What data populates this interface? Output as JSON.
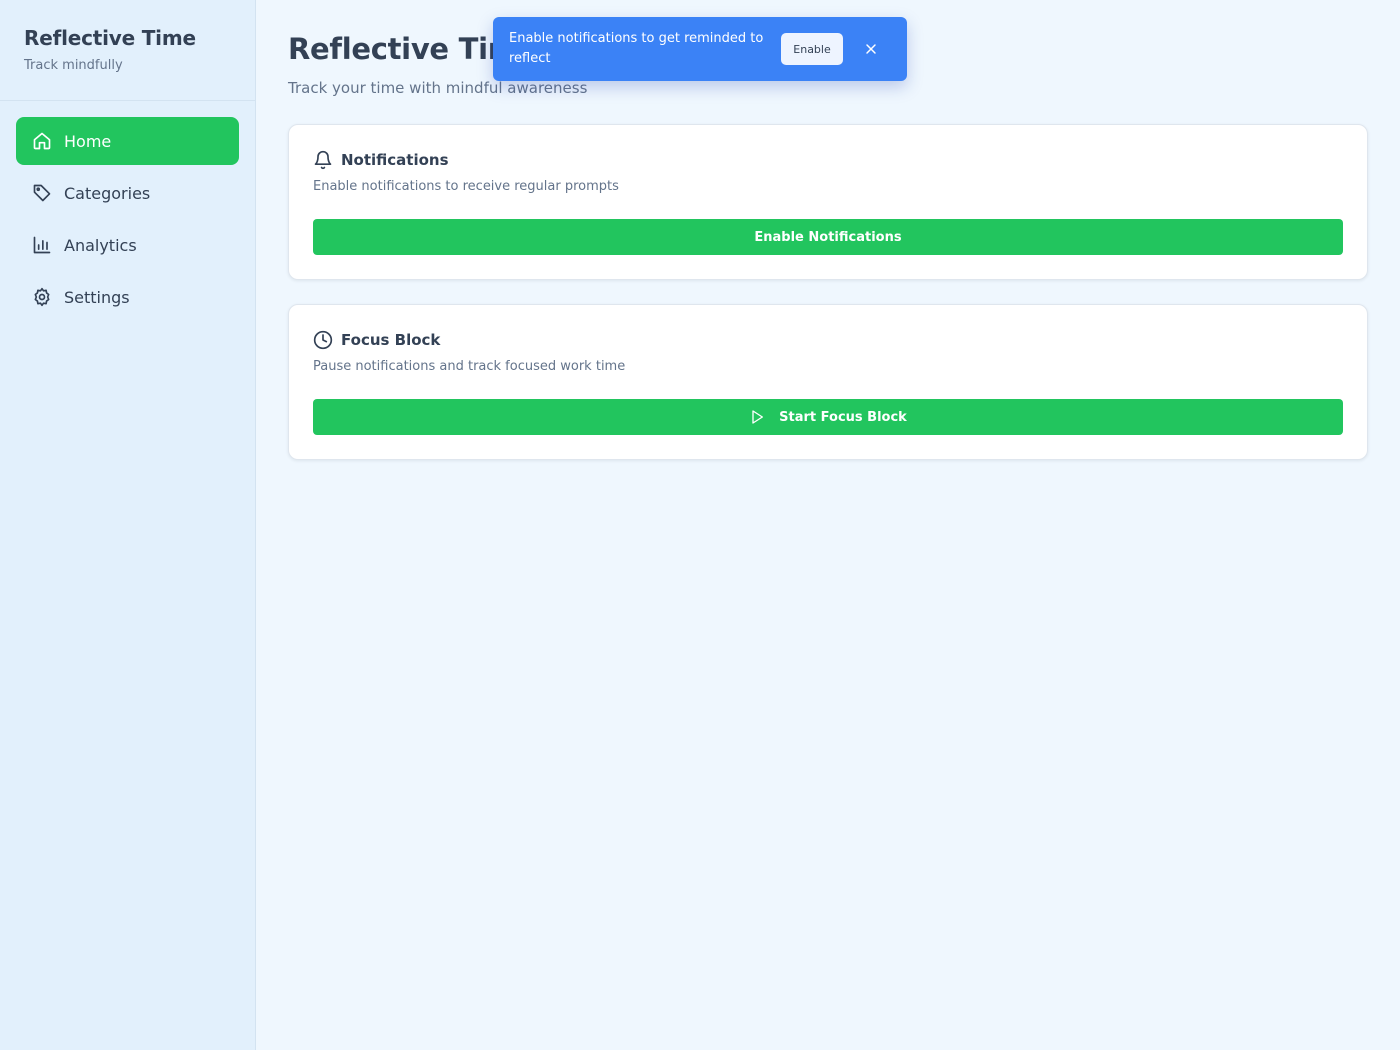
{
  "sidebar": {
    "title": "Reflective Time",
    "subtitle": "Track mindfully",
    "items": [
      {
        "label": "Home",
        "icon": "home-icon",
        "active": true
      },
      {
        "label": "Categories",
        "icon": "tag-icon"
      },
      {
        "label": "Analytics",
        "icon": "bar-chart-icon"
      },
      {
        "label": "Settings",
        "icon": "gear-icon"
      }
    ]
  },
  "header": {
    "title": "Reflective Time",
    "subtitle": "Track your time with mindful awareness"
  },
  "cards": {
    "notifications": {
      "title": "Notifications",
      "description": "Enable notifications to receive regular prompts",
      "button": "Enable Notifications",
      "icon": "bell-icon"
    },
    "focus": {
      "title": "Focus Block",
      "description": "Pause notifications and track focused work time",
      "button": "Start Focus Block",
      "icon": "clock-icon",
      "button_icon": "play-icon"
    }
  },
  "toast": {
    "message": "Enable notifications to get reminded to reflect",
    "button": "Enable",
    "close_icon": "close-icon"
  },
  "colors": {
    "accent": "#22c55e",
    "toast": "#3b82f6",
    "sidebar_bg": "#e2f0fc",
    "page_bg": "#eff7fe"
  }
}
